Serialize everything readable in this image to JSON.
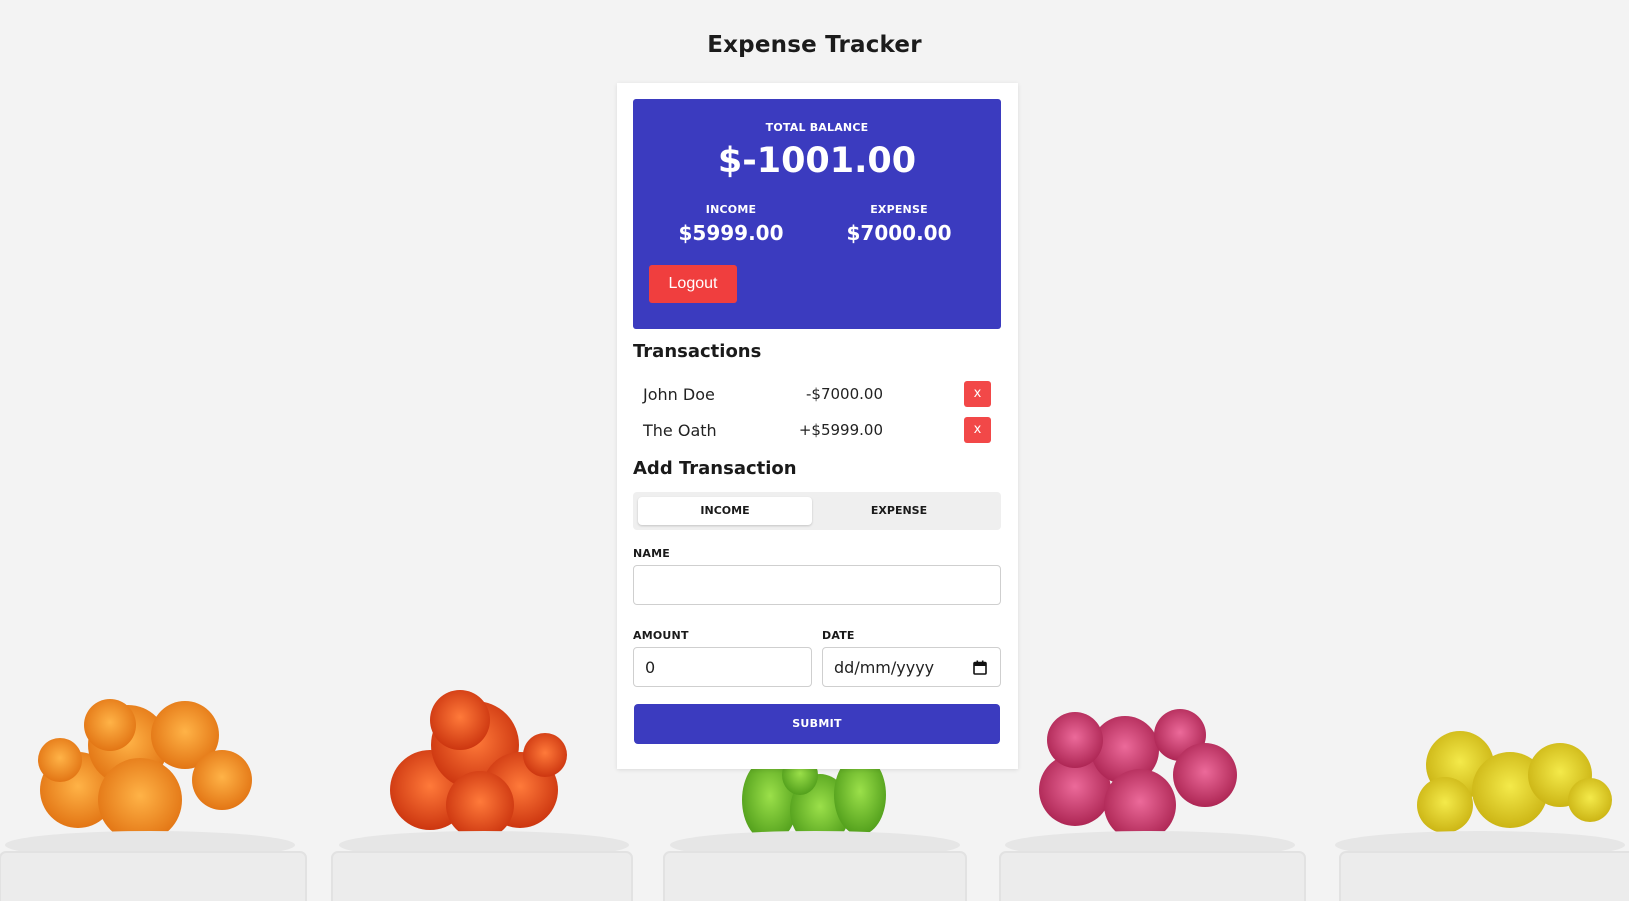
{
  "app": {
    "title": "Expense Tracker"
  },
  "balance": {
    "total_label": "TOTAL BALANCE",
    "total_value": "$-1001.00",
    "income_label": "INCOME",
    "income_value": "$5999.00",
    "expense_label": "EXPENSE",
    "expense_value": "$7000.00",
    "logout_label": "Logout"
  },
  "transactions": {
    "title": "Transactions",
    "items": [
      {
        "name": "John Doe",
        "amount": "-$7000.00",
        "delete_label": "x"
      },
      {
        "name": "The Oath",
        "amount": "+$5999.00",
        "delete_label": "x"
      }
    ]
  },
  "add_transaction": {
    "title": "Add Transaction",
    "type_toggle": {
      "income_label": "INCOME",
      "expense_label": "EXPENSE",
      "selected": "INCOME"
    },
    "name_label": "NAME",
    "name_value": "",
    "amount_label": "AMOUNT",
    "amount_value": "0",
    "date_label": "DATE",
    "date_placeholder": "dd/mm/yyyy",
    "submit_label": "SUBMIT"
  },
  "colors": {
    "accent": "#3b3bbf",
    "danger": "#f03e3e",
    "background": "#f3f3f3",
    "cactus_colors": [
      "#f08a1c",
      "#e8421a",
      "#6cc22a",
      "#c8336b",
      "#d8c41a"
    ]
  },
  "icons": {
    "date_picker": "calendar-icon",
    "delete": "close-icon"
  }
}
